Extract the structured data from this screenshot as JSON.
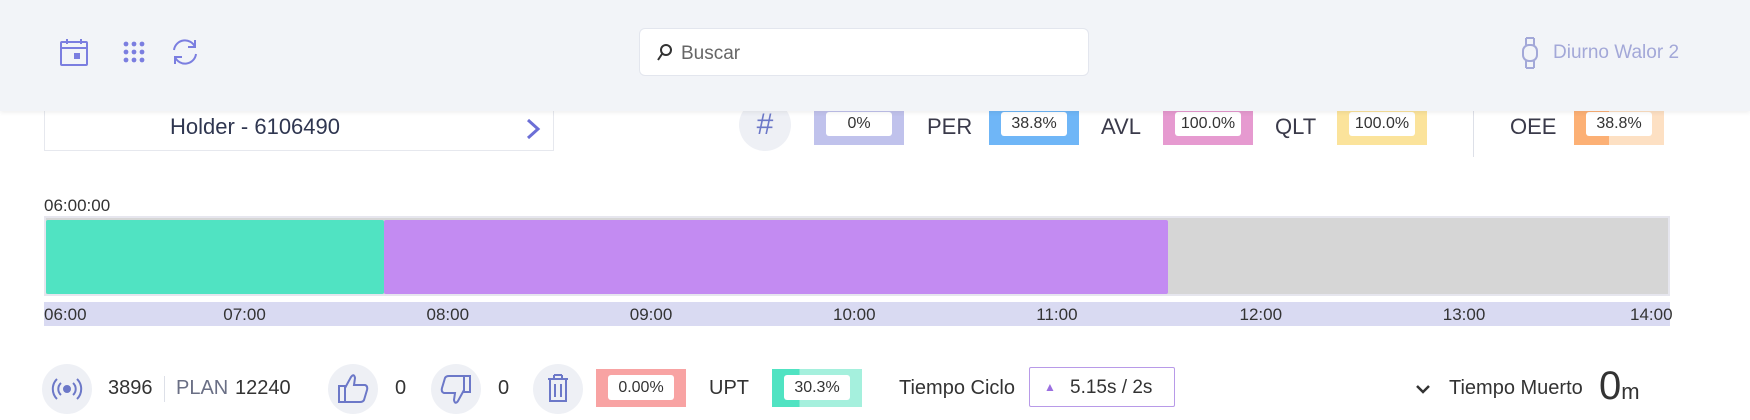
{
  "header": {
    "icons": [
      "calendar-icon",
      "grid-icon",
      "refresh-icon"
    ],
    "search_placeholder": "Buscar",
    "user_name": "Diurno Walor 2"
  },
  "holder": {
    "label": "Holder - 6106490"
  },
  "kpis": {
    "first": {
      "value": "0%",
      "color": "#c0c2ec"
    },
    "per": {
      "label": "PER",
      "value": "38.8%",
      "color": "#6fb6f7"
    },
    "avl": {
      "label": "AVL",
      "value": "100.0%",
      "color": "#e69ad0"
    },
    "qlt": {
      "label": "QLT",
      "value": "100.0%",
      "color": "#fbe39b"
    },
    "oee": {
      "label": "OEE",
      "value": "38.8%",
      "color_fill": "#fcb075",
      "color_rest": "#fde0c3",
      "fill_fraction": 0.388
    }
  },
  "timeline": {
    "start_label": "06:00:00",
    "range": [
      "06:00",
      "14:00"
    ],
    "ticks": [
      "06:00",
      "07:00",
      "08:00",
      "09:00",
      "10:00",
      "11:00",
      "12:00",
      "13:00",
      "14:00"
    ],
    "segments": [
      {
        "start": "06:00",
        "end": "07:40",
        "state": "teal",
        "color": "#50e3c2"
      },
      {
        "start": "07:40",
        "end": "11:32",
        "state": "purple",
        "color": "#c38bf2"
      }
    ]
  },
  "bottom": {
    "count": "3896",
    "plan_label": "PLAN",
    "plan_value": "12240",
    "good": "0",
    "bad": "0",
    "waste_pct": {
      "value": "0.00%",
      "color": "#f8a3a3"
    },
    "upt": {
      "label": "UPT",
      "value": "30.3%",
      "color_fill": "#50e3c2",
      "color_rest": "#a5f0dd",
      "fill_fraction": 0.303
    },
    "cycle": {
      "label": "Tiempo Ciclo",
      "value": "5.15s  /  2s"
    },
    "muerto": {
      "label": "Tiempo Muerto",
      "value": "0",
      "unit": "m"
    }
  }
}
